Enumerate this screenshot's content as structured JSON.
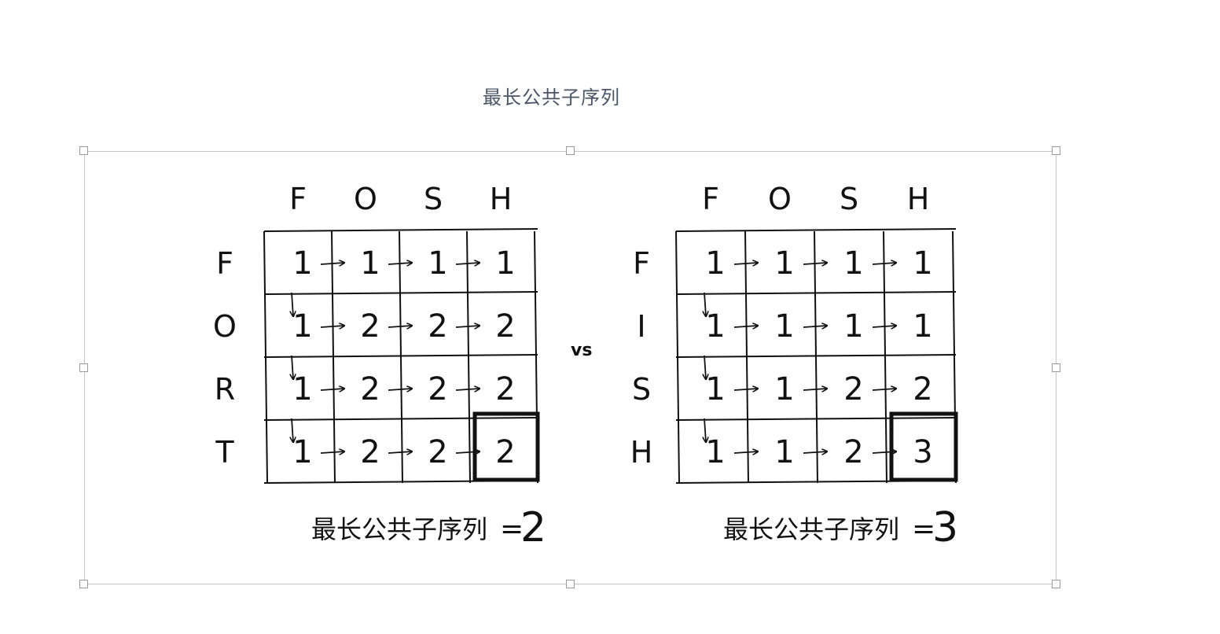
{
  "document": {
    "caption": "最长公共子序列"
  },
  "left_grid": {
    "col_headers": [
      "F",
      "O",
      "S",
      "H"
    ],
    "row_headers": [
      "F",
      "O",
      "R",
      "T"
    ],
    "cells": [
      [
        "1",
        "1",
        "1",
        "1"
      ],
      [
        "1",
        "2",
        "2",
        "2"
      ],
      [
        "1",
        "2",
        "2",
        "2"
      ],
      [
        "1",
        "2",
        "2",
        "2"
      ]
    ],
    "result_label": "最长公共子序列",
    "result_eq": "=",
    "result_value": "2"
  },
  "right_grid": {
    "col_headers": [
      "F",
      "O",
      "S",
      "H"
    ],
    "row_headers": [
      "F",
      "I",
      "S",
      "H"
    ],
    "cells": [
      [
        "1",
        "1",
        "1",
        "1"
      ],
      [
        "1",
        "1",
        "1",
        "1"
      ],
      [
        "1",
        "1",
        "2",
        "2"
      ],
      [
        "1",
        "1",
        "2",
        "3"
      ]
    ],
    "result_label": "最长公共子序列",
    "result_eq": "=",
    "result_value": "3"
  },
  "vs_label": "vs"
}
